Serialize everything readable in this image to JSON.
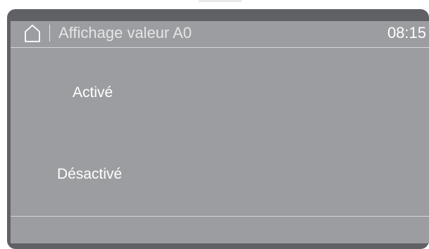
{
  "header": {
    "title": "Affichage valeur A0",
    "time": "08:15"
  },
  "options": [
    {
      "label": "Activé"
    },
    {
      "label": "Désactivé"
    }
  ]
}
